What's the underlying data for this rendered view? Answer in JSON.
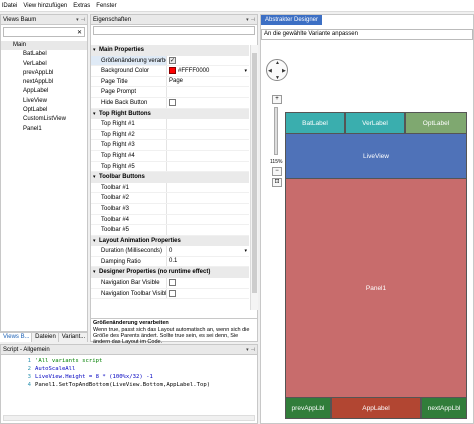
{
  "menu": [
    "lDatei",
    "View hinzufügen",
    "Extras",
    "Fenster"
  ],
  "views_panel": {
    "title": "Views Baum",
    "root": "Main",
    "children": [
      "BatLabel",
      "VerLabel",
      "prevAppLbl",
      "nextAppLbl",
      "AppLabel",
      "LiveView",
      "OptLabel",
      "CustomListView",
      "Panel1"
    ],
    "tabs": [
      "Views B...",
      "Dateien",
      "Variant..."
    ]
  },
  "properties_panel": {
    "title": "Eigenschaften",
    "categories": [
      {
        "name": "Main Properties",
        "rows": [
          {
            "key": "Größenänderung verarbe...",
            "value": "",
            "type": "checkbox",
            "checked": true
          },
          {
            "key": "Background Color",
            "value": "#FFFF0000",
            "type": "color",
            "color": "#ff0000"
          },
          {
            "key": "Page Title",
            "value": "Page",
            "type": "text"
          },
          {
            "key": "Page Prompt",
            "value": "",
            "type": "text"
          },
          {
            "key": "Hide Back Button",
            "value": "",
            "type": "checkbox",
            "checked": false
          }
        ]
      },
      {
        "name": "Top Right Buttons",
        "rows": [
          {
            "key": "Top Right #1",
            "value": "",
            "type": "text"
          },
          {
            "key": "Top Right #2",
            "value": "",
            "type": "text"
          },
          {
            "key": "Top Right #3",
            "value": "",
            "type": "text"
          },
          {
            "key": "Top Right #4",
            "value": "",
            "type": "text"
          },
          {
            "key": "Top Right #5",
            "value": "",
            "type": "text"
          }
        ]
      },
      {
        "name": "Toolbar Buttons",
        "rows": [
          {
            "key": "Toolbar #1",
            "value": "",
            "type": "text"
          },
          {
            "key": "Toolbar #2",
            "value": "",
            "type": "text"
          },
          {
            "key": "Toolbar #3",
            "value": "",
            "type": "text"
          },
          {
            "key": "Toolbar #4",
            "value": "",
            "type": "text"
          },
          {
            "key": "Toolbar #5",
            "value": "",
            "type": "text"
          }
        ]
      },
      {
        "name": "Layout Animation Properties",
        "rows": [
          {
            "key": "Duration (Milliseconds)",
            "value": "0",
            "type": "dropdown"
          },
          {
            "key": "Damping Ratio",
            "value": "0.1",
            "type": "text"
          }
        ]
      },
      {
        "name": "Designer Properties (no runtime effect)",
        "rows": [
          {
            "key": "Navigation Bar Visible",
            "value": "",
            "type": "checkbox",
            "checked": false
          },
          {
            "key": "Navigation Toolbar Visible",
            "value": "",
            "type": "checkbox",
            "checked": false
          }
        ]
      }
    ],
    "description_title": "Größenänderung verarbeiten",
    "description_text": "Wenn true, passt sich das Layout automatisch an, wenn sich die Größe des Parents ändert. Sollte true sein, es sei denn, Sie ändern das Layout im Code."
  },
  "designer": {
    "tab": "Abstrakter Designer",
    "variant": "An die gewählte Variante anpassen",
    "zoom": "115%",
    "blocks": {
      "batlabel": "BatLabel",
      "verlabel": "VerLabel",
      "optlabel": "OptLabel",
      "liveview": "LiveView",
      "panel1": "Panel1",
      "prev": "prevAppLbl",
      "app": "AppLabel",
      "next": "nextAppLbl"
    }
  },
  "script_panel": {
    "title": "Script - Allgemein",
    "lines": [
      {
        "num": "1",
        "code": "'All variants script"
      },
      {
        "num": "2",
        "code": "AutoScaleAll"
      },
      {
        "num": "3",
        "code": "LiveView.Height = 8 * (100%x/32) -1"
      },
      {
        "num": "4",
        "code": "Panel1.SetTopAndBottom(LiveView.Bottom,AppLabel.Top)"
      }
    ]
  },
  "colors": {
    "accent": "#3c6fc4",
    "teal": "#3aaeae",
    "green": "#7fa870",
    "blue": "#4f72b8",
    "red": "#c86c6c",
    "darkgreen": "#317d3a",
    "darkred": "#b24632"
  }
}
